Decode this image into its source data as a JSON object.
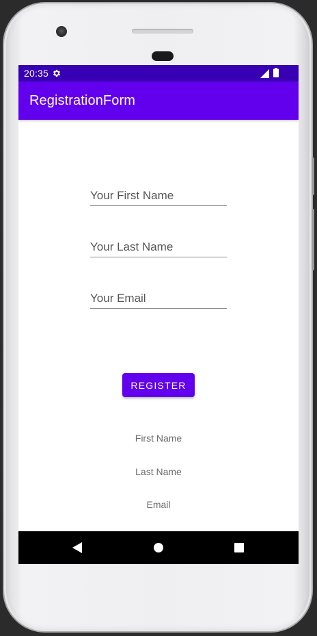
{
  "status_bar": {
    "time": "20:35",
    "settings_icon": "gear-icon",
    "signal_icon": "cell-signal-icon",
    "battery_icon": "battery-icon",
    "background": "#3700b3"
  },
  "app_bar": {
    "title": "RegistrationForm",
    "background": "#6200ee"
  },
  "form": {
    "first_name": {
      "placeholder": "Your First Name",
      "value": ""
    },
    "last_name": {
      "placeholder": "Your Last Name",
      "value": ""
    },
    "email": {
      "placeholder": "Your Email",
      "value": ""
    },
    "register_label": "REGISTER"
  },
  "results": {
    "first_name": "First Name",
    "last_name": "Last Name",
    "email": "Email"
  },
  "nav_bar": {
    "back_icon": "back-triangle-icon",
    "home_icon": "home-circle-icon",
    "recents_icon": "recents-square-icon"
  },
  "colors": {
    "primary": "#6200ee",
    "primary_dark": "#3700b3",
    "on_primary": "#ffffff"
  }
}
